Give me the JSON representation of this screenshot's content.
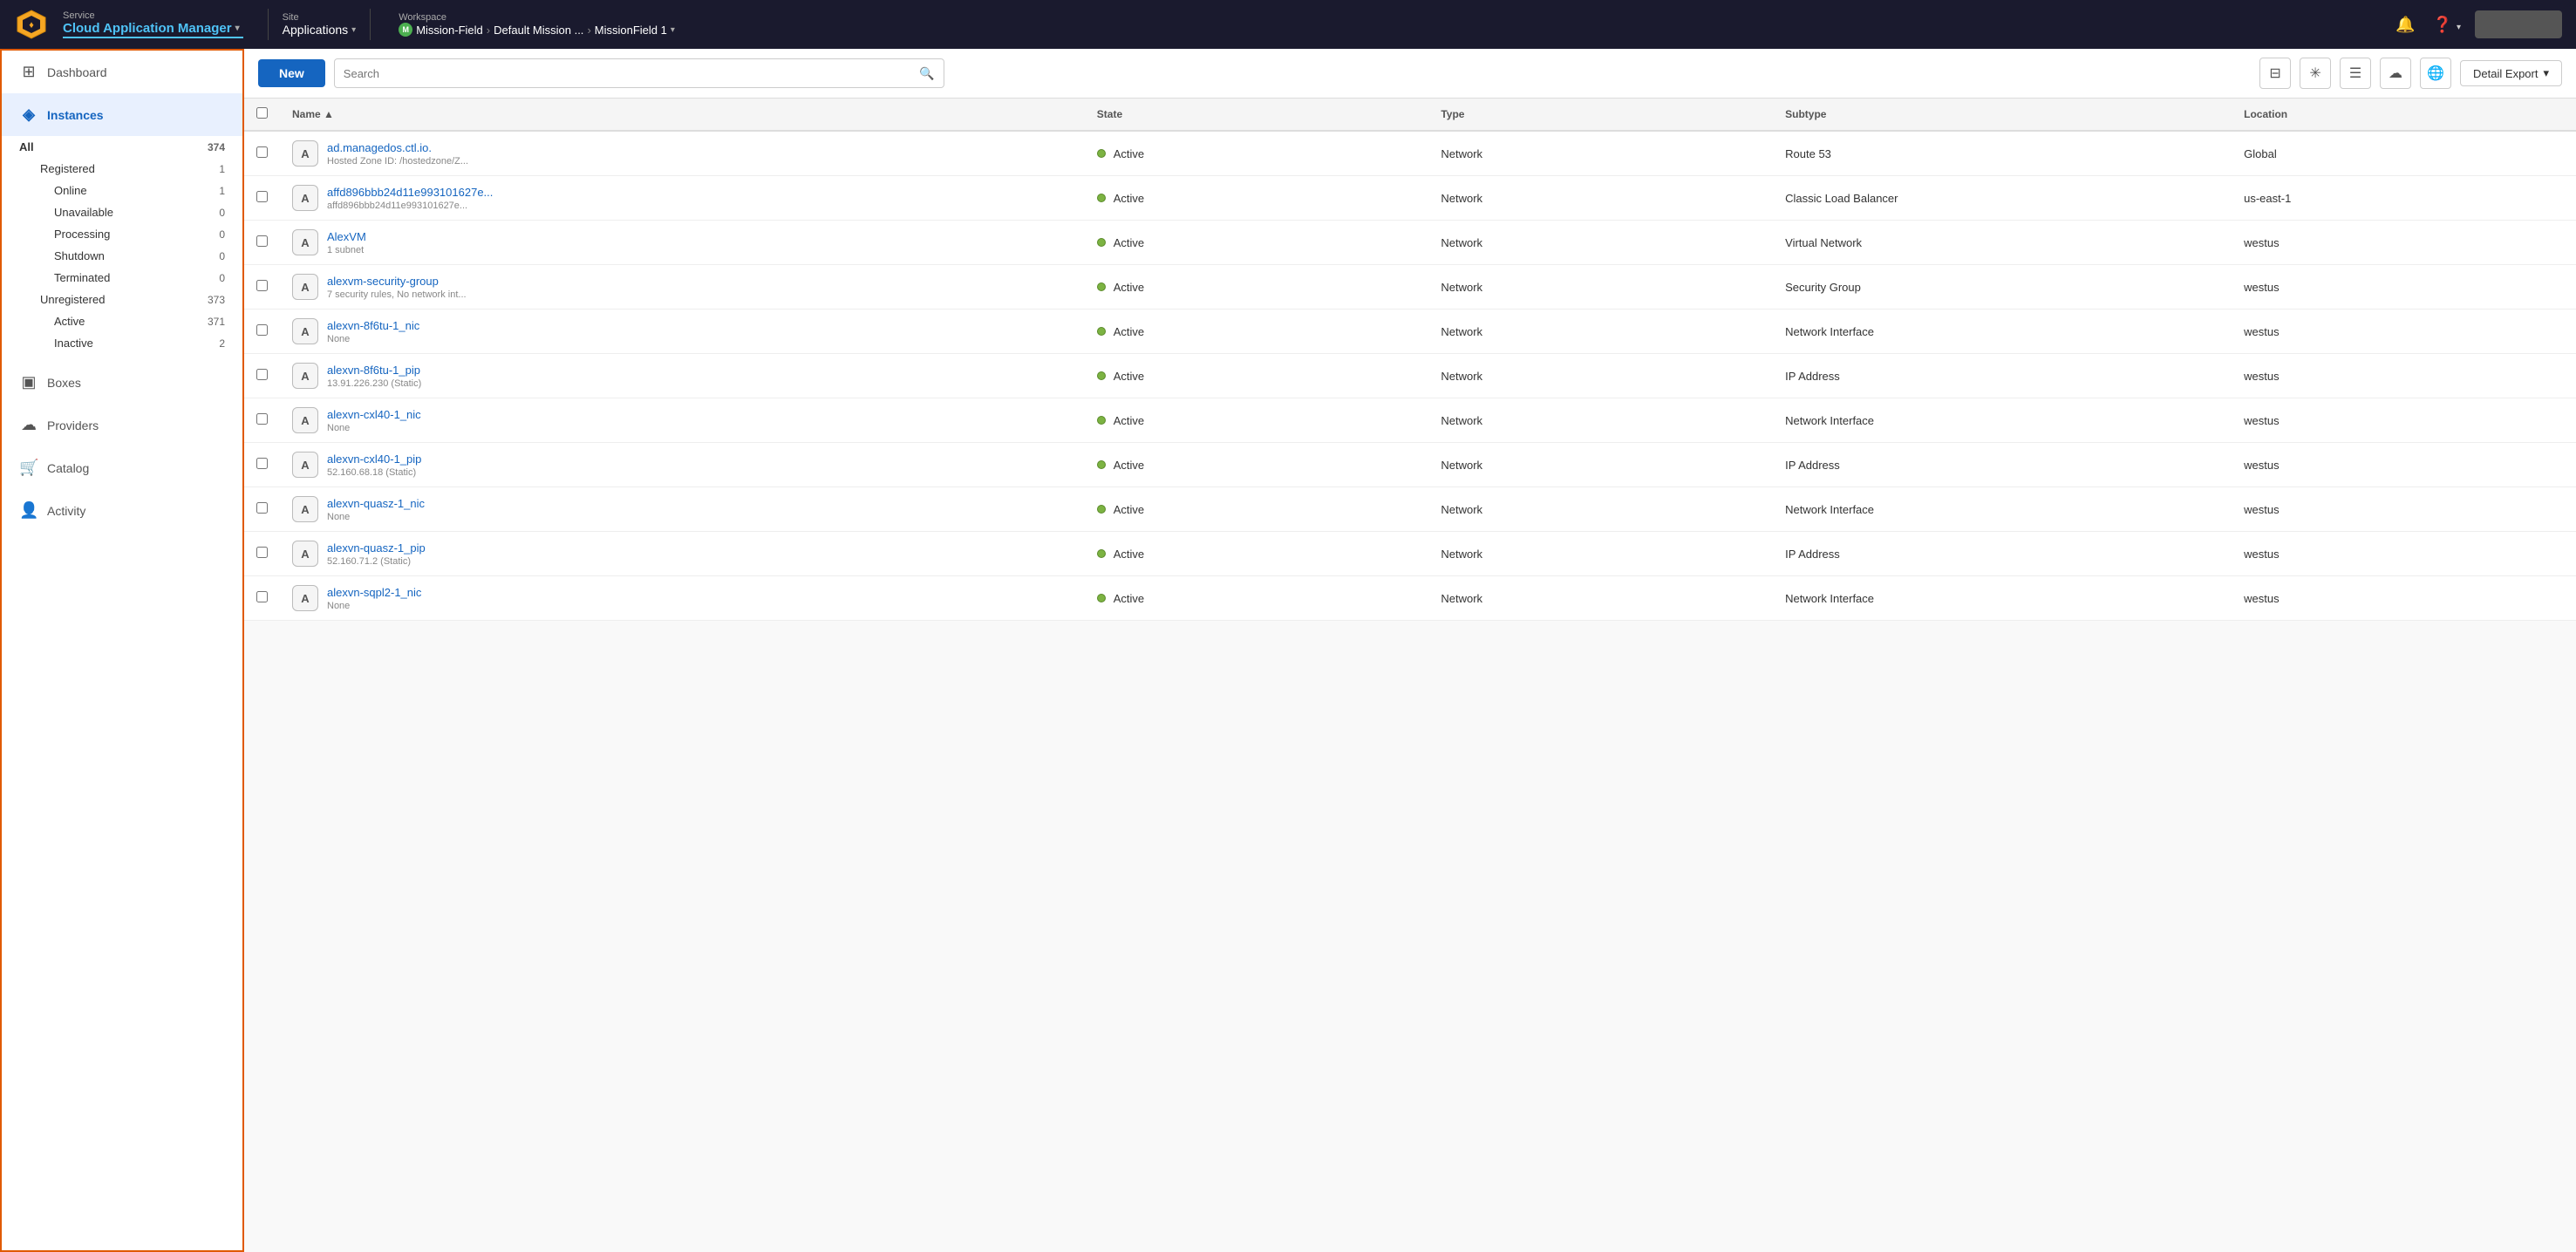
{
  "topnav": {
    "service_label": "Service",
    "service_name": "Cloud Application Manager",
    "site_label": "Site",
    "site_name": "Applications",
    "workspace_label": "Workspace",
    "workspace_path": [
      "Mission-Field",
      "Default Mission ...",
      "MissionField 1"
    ],
    "user_button": ""
  },
  "sidebar": {
    "items": [
      {
        "id": "dashboard",
        "label": "Dashboard",
        "icon": "⊞"
      },
      {
        "id": "instances",
        "label": "Instances",
        "icon": "◈",
        "active": true
      },
      {
        "id": "boxes",
        "label": "Boxes",
        "icon": "▣"
      },
      {
        "id": "providers",
        "label": "Providers",
        "icon": "☁"
      },
      {
        "id": "catalog",
        "label": "Catalog",
        "icon": "🛒"
      },
      {
        "id": "activity",
        "label": "Activity",
        "icon": "👤"
      }
    ],
    "instances_subnav": [
      {
        "label": "All",
        "count": "374",
        "level": 1,
        "bold": true
      },
      {
        "label": "Registered",
        "count": "1",
        "level": 1
      },
      {
        "label": "Online",
        "count": "1",
        "level": 2
      },
      {
        "label": "Unavailable",
        "count": "0",
        "level": 2
      },
      {
        "label": "Processing",
        "count": "0",
        "level": 2
      },
      {
        "label": "Shutdown",
        "count": "0",
        "level": 2
      },
      {
        "label": "Terminated",
        "count": "0",
        "level": 2
      },
      {
        "label": "Unregistered",
        "count": "373",
        "level": 1
      },
      {
        "label": "Active",
        "count": "371",
        "level": 2
      },
      {
        "label": "Inactive",
        "count": "2",
        "level": 2
      }
    ]
  },
  "toolbar": {
    "new_label": "New",
    "search_placeholder": "Search",
    "detail_export_label": "Detail Export"
  },
  "table": {
    "columns": [
      "",
      "Name",
      "State",
      "Type",
      "Subtype",
      "Location"
    ],
    "rows": [
      {
        "avatar": "A",
        "name": "ad.managedos.ctl.io.",
        "sub": "Hosted Zone ID: /hostedzone/Z...",
        "state": "Active",
        "type": "Network",
        "subtype": "Route 53",
        "location": "Global"
      },
      {
        "avatar": "A",
        "name": "affd896bbb24d11e993101627e...",
        "sub": "affd896bbb24d11e993101627e...",
        "state": "Active",
        "type": "Network",
        "subtype": "Classic Load Balancer",
        "location": "us-east-1"
      },
      {
        "avatar": "A",
        "name": "AlexVM",
        "sub": "1 subnet",
        "state": "Active",
        "type": "Network",
        "subtype": "Virtual Network",
        "location": "westus"
      },
      {
        "avatar": "A",
        "name": "alexvm-security-group",
        "sub": "7 security rules, No network int...",
        "state": "Active",
        "type": "Network",
        "subtype": "Security Group",
        "location": "westus"
      },
      {
        "avatar": "A",
        "name": "alexvn-8f6tu-1_nic",
        "sub": "None",
        "state": "Active",
        "type": "Network",
        "subtype": "Network Interface",
        "location": "westus"
      },
      {
        "avatar": "A",
        "name": "alexvn-8f6tu-1_pip",
        "sub": "13.91.226.230 (Static)",
        "state": "Active",
        "type": "Network",
        "subtype": "IP Address",
        "location": "westus"
      },
      {
        "avatar": "A",
        "name": "alexvn-cxl40-1_nic",
        "sub": "None",
        "state": "Active",
        "type": "Network",
        "subtype": "Network Interface",
        "location": "westus"
      },
      {
        "avatar": "A",
        "name": "alexvn-cxl40-1_pip",
        "sub": "52.160.68.18 (Static)",
        "state": "Active",
        "type": "Network",
        "subtype": "IP Address",
        "location": "westus"
      },
      {
        "avatar": "A",
        "name": "alexvn-quasz-1_nic",
        "sub": "None",
        "state": "Active",
        "type": "Network",
        "subtype": "Network Interface",
        "location": "westus"
      },
      {
        "avatar": "A",
        "name": "alexvn-quasz-1_pip",
        "sub": "52.160.71.2 (Static)",
        "state": "Active",
        "type": "Network",
        "subtype": "IP Address",
        "location": "westus"
      },
      {
        "avatar": "A",
        "name": "alexvn-sqpl2-1_nic",
        "sub": "None",
        "state": "Active",
        "type": "Network",
        "subtype": "Network Interface",
        "location": "westus"
      }
    ]
  },
  "colors": {
    "active_dot": "#7cb342",
    "brand_blue": "#1565c0",
    "nav_bg": "#1a1a2e"
  }
}
